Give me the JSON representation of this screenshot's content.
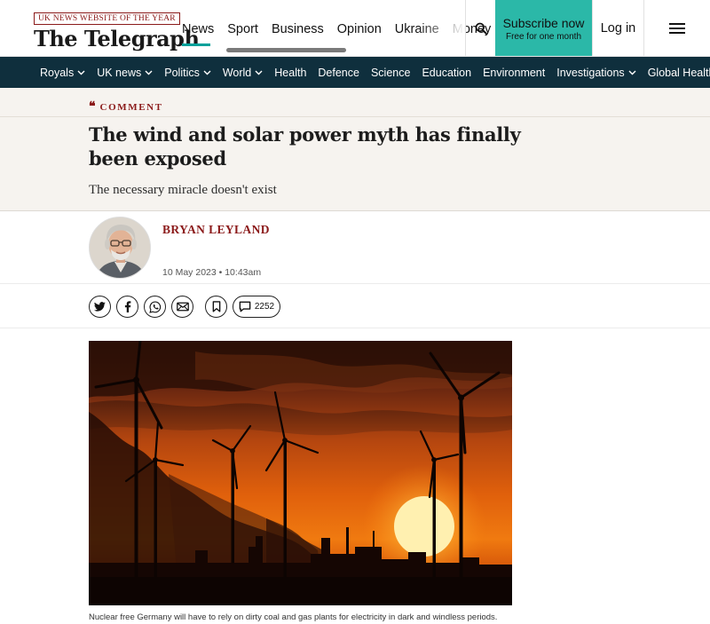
{
  "header": {
    "award": "UK NEWS WEBSITE OF THE YEAR",
    "logo": "The Telegraph",
    "nav": [
      "News",
      "Sport",
      "Business",
      "Opinion",
      "Ukraine",
      "Money"
    ],
    "active_nav": "News",
    "search_icon": "search-icon",
    "subscribe_title": "Subscribe now",
    "subscribe_sub": "Free for one month",
    "login": "Log in",
    "menu_icon": "hamburger-menu-icon",
    "accent_color": "#2bb8a8"
  },
  "section_nav": {
    "items": [
      {
        "label": "Royals",
        "dropdown": true
      },
      {
        "label": "UK news",
        "dropdown": true
      },
      {
        "label": "Politics",
        "dropdown": true
      },
      {
        "label": "World",
        "dropdown": true
      },
      {
        "label": "Health",
        "dropdown": false
      },
      {
        "label": "Defence",
        "dropdown": false
      },
      {
        "label": "Science",
        "dropdown": false
      },
      {
        "label": "Education",
        "dropdown": false
      },
      {
        "label": "Environment",
        "dropdown": false
      },
      {
        "label": "Investigations",
        "dropdown": true
      },
      {
        "label": "Global Health Secur",
        "dropdown": false
      }
    ],
    "background": "#0f2f3d"
  },
  "article": {
    "kicker": "COMMENT",
    "headline": "The wind and solar power myth has finally been exposed",
    "standfirst": "The necessary miracle doesn't exist",
    "author": "BRYAN LEYLAND",
    "date": "10 May 2023 • 10:43am",
    "comment_count": "2252",
    "share_icons": [
      "twitter-icon",
      "facebook-icon",
      "whatsapp-icon",
      "email-icon"
    ],
    "bookmark_icon": "bookmark-icon",
    "caption": "Nuclear free Germany will have to rely on dirty coal and gas plants for electricity in dark and windless periods."
  }
}
